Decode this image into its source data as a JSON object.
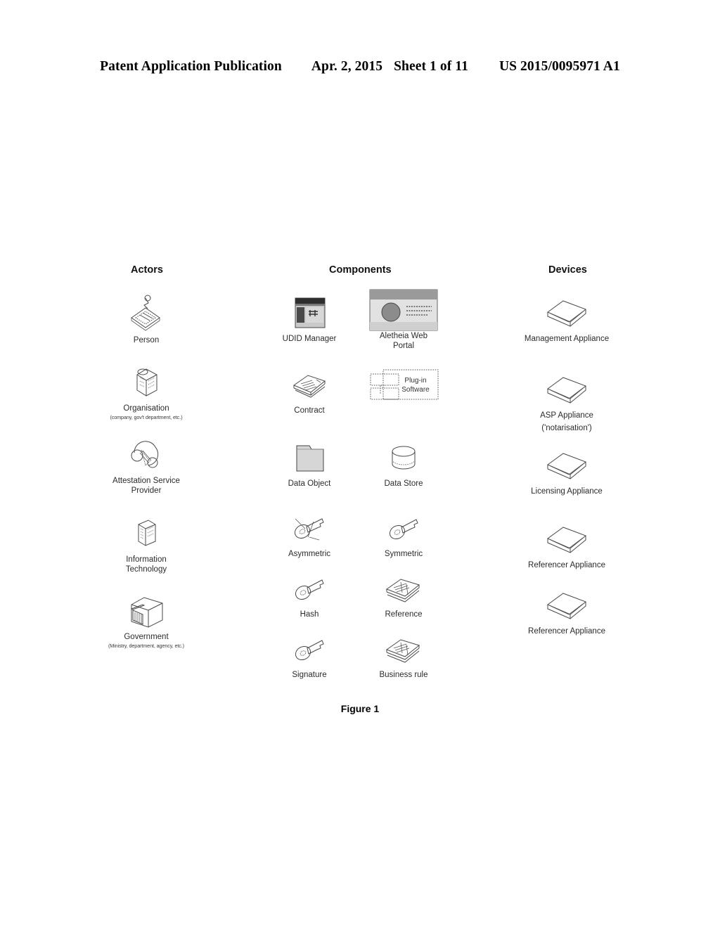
{
  "header": {
    "title": "Patent Application Publication",
    "date": "Apr. 2, 2015",
    "sheet": "Sheet 1 of 11",
    "number": "US 2015/0095971 A1"
  },
  "figure": {
    "caption": "Figure 1",
    "columns": [
      {
        "id": "actors",
        "title": "Actors"
      },
      {
        "id": "components",
        "title": "Components"
      },
      {
        "id": "devices",
        "title": "Devices"
      }
    ],
    "actors": [
      {
        "icon": "person-icon",
        "label": "Person",
        "sub": ""
      },
      {
        "icon": "organisation-icon",
        "label": "Organisation",
        "sub": "(company, gov't department, etc.)"
      },
      {
        "icon": "attestation-service-provider-icon",
        "label": "Attestation Service\nProvider",
        "sub": ""
      },
      {
        "icon": "information-technology-icon",
        "label": "Information\nTechnology",
        "sub": ""
      },
      {
        "icon": "government-icon",
        "label": "Government",
        "sub": "(Ministry, department, agency, etc.)"
      }
    ],
    "components_left": [
      {
        "icon": "udid-manager-icon",
        "label": "UDID Manager"
      },
      {
        "icon": "contract-icon",
        "label": "Contract"
      },
      {
        "icon": "data-object-icon",
        "label": "Data Object"
      },
      {
        "icon": "asymmetric-key-icon",
        "label": "Asymmetric"
      },
      {
        "icon": "hash-key-icon",
        "label": "Hash"
      },
      {
        "icon": "signature-key-icon",
        "label": "Signature"
      }
    ],
    "components_right": [
      {
        "icon": "aletheia-web-portal-icon",
        "label": "Aletheia Web\nPortal",
        "inner_text": ""
      },
      {
        "icon": "plugin-software-icon",
        "label": "",
        "inner_text": "Plug-in\nSoftware"
      },
      {
        "icon": "data-store-icon",
        "label": "Data Store"
      },
      {
        "icon": "symmetric-key-icon",
        "label": "Symmetric"
      },
      {
        "icon": "reference-icon",
        "label": "Reference"
      },
      {
        "icon": "business-rule-icon",
        "label": "Business rule"
      }
    ],
    "devices": [
      {
        "icon": "appliance-icon",
        "label": "Management Appliance",
        "sub": ""
      },
      {
        "icon": "appliance-icon",
        "label": "ASP Appliance",
        "sub": "('notarisation')"
      },
      {
        "icon": "appliance-icon",
        "label": "Licensing Appliance",
        "sub": ""
      },
      {
        "icon": "appliance-icon",
        "label": "Referencer Appliance",
        "sub": ""
      },
      {
        "icon": "appliance-icon",
        "label": "Referencer Appliance",
        "sub": ""
      }
    ]
  }
}
